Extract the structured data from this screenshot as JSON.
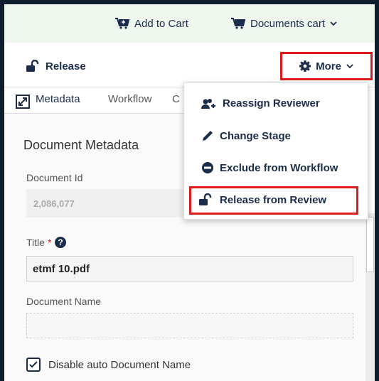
{
  "topbar": {
    "add_to_cart": "Add to Cart",
    "documents_cart": "Documents cart"
  },
  "actionbar": {
    "release": "Release",
    "more": "More"
  },
  "tabs": [
    {
      "label": "Metadata"
    },
    {
      "label": "Workflow"
    },
    {
      "label": "C"
    }
  ],
  "form": {
    "section_title": "Document Metadata",
    "document_id_label": "Document Id",
    "document_id_value": "2,086,077",
    "title_label": "Title",
    "required_mark": "*",
    "title_value": "etmf 10.pdf",
    "document_name_label": "Document Name",
    "document_name_value": "",
    "disable_auto_label": "Disable auto Document Name",
    "disable_auto_checked": true
  },
  "more_menu": {
    "items": [
      {
        "label": "Reassign Reviewer",
        "icon": "user-plus-icon"
      },
      {
        "label": "Change Stage",
        "icon": "pencil-icon"
      },
      {
        "label": "Exclude from Workflow",
        "icon": "minus-circle-icon"
      },
      {
        "label": "Release from Review",
        "icon": "unlock-icon"
      }
    ]
  },
  "colors": {
    "highlight": "#e01b1b",
    "navy": "#1b2d4a",
    "topbar_bg": "#eef6ee"
  }
}
